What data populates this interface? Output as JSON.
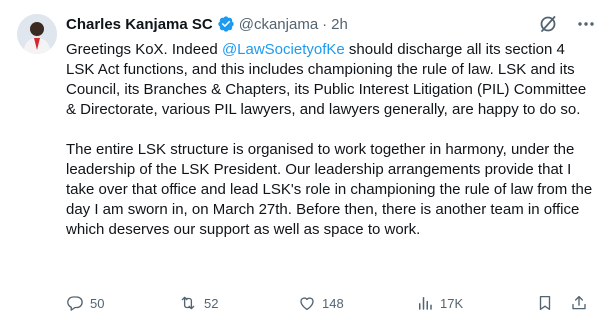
{
  "author": {
    "name": "Charles Kanjama SC",
    "handle": "@ckanjama",
    "separator": "·",
    "time": "2h",
    "verified": true,
    "avatar": "profile-photo"
  },
  "header_actions": {
    "grok_icon": "grok-slash-icon",
    "more_icon": "more-dots-icon"
  },
  "tweet": {
    "p1_before": "Greetings KoX. Indeed ",
    "p1_mention": "@LawSocietyofKe",
    "p1_after": " should discharge all its section 4 LSK Act functions, and this includes championing the rule of law. LSK and its Council, its Branches & Chapters, its Public Interest Litigation (PIL) Committee & Directorate, various PIL lawyers, and lawyers generally, are happy to do so.",
    "p2": "The entire LSK structure is organised to work together in harmony, under the leadership of the LSK President. Our leadership arrangements provide that I take over that office and lead LSK's role in championing the rule of law from the day I am sworn in, on March 27th. Before then, there is another team in office which deserves our support as well as space to work."
  },
  "actions": {
    "replies": "50",
    "reposts": "52",
    "likes": "148",
    "views": "17K"
  },
  "colors": {
    "accent": "#1d9bf0",
    "secondary_text": "#536471",
    "primary_text": "#0f1419"
  }
}
